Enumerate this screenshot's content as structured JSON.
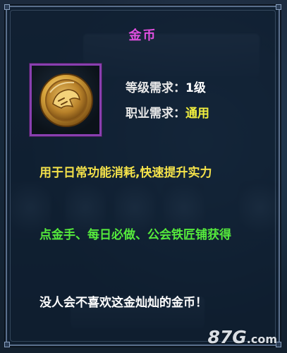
{
  "tooltip": {
    "title": "金币",
    "item_icon": "gold-coin-icon",
    "level_req_label": "等级需求：",
    "level_req_value": "1级",
    "class_req_label": "职业需求：",
    "class_req_value": "通用",
    "description": "用于日常功能消耗,快速提升实力",
    "source": "点金手、每日必做、公会铁匠铺获得",
    "flavor_text": "没人会不喜欢这金灿灿的金币！"
  },
  "watermark": {
    "main": "87G",
    "suffix": ".com"
  },
  "colors": {
    "title": "#e14fe0",
    "icon_border": "#8a3fb0",
    "class_value": "#f1ef3f",
    "description": "#f4e24a",
    "source": "#55ea3c",
    "flavor": "#ffffff"
  }
}
